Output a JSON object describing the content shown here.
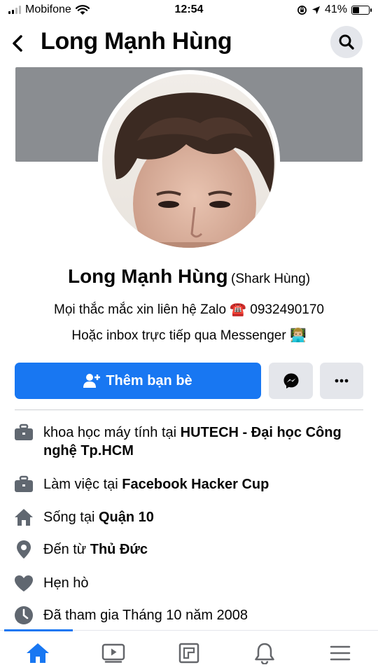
{
  "status_bar": {
    "carrier": "Mobifone",
    "time": "12:54",
    "battery_percent": "41%",
    "battery_level": 0.41,
    "icons": [
      "signal-icon",
      "wifi-icon",
      "rotation-lock-icon",
      "location-icon",
      "battery-icon"
    ]
  },
  "header": {
    "title": "Long Mạnh Hùng",
    "back_icon": "back-chevron-icon",
    "search_icon": "search-icon"
  },
  "profile": {
    "name": "Long Mạnh Hùng",
    "alt_name": "(Shark Hùng)",
    "bio_line1": "Mọi thắc mắc xin liên hệ Zalo ☎️ 0932490170",
    "bio_line2": "Hoặc  inbox trực tiếp qua Messenger 👨🏼‍💻"
  },
  "actions": {
    "add_friend_label": "Thêm bạn bè",
    "add_friend_icon": "add-friend-icon",
    "messenger_icon": "messenger-icon",
    "more_icon": "more-dots-icon",
    "accent_color": "#1877f2"
  },
  "details": [
    {
      "icon": "briefcase-icon",
      "prefix": "khoa học máy tính tại ",
      "bold": "HUTECH - Đại học Công nghệ Tp.HCM"
    },
    {
      "icon": "briefcase-icon",
      "prefix": "Làm việc tại ",
      "bold": "Facebook Hacker Cup"
    },
    {
      "icon": "home-icon",
      "prefix": "Sống tại ",
      "bold": "Quận 10"
    },
    {
      "icon": "location-pin-icon",
      "prefix": "Đến từ ",
      "bold": "Thủ Đức"
    },
    {
      "icon": "heart-icon",
      "prefix": "Hẹn hò",
      "bold": ""
    },
    {
      "icon": "clock-icon",
      "prefix": "Đã tham gia Tháng 10 năm 2008",
      "bold": ""
    }
  ],
  "bottom_nav": {
    "items": [
      "home-icon",
      "watch-icon",
      "pages-icon",
      "notifications-icon",
      "menu-icon"
    ],
    "active": "home-icon"
  }
}
